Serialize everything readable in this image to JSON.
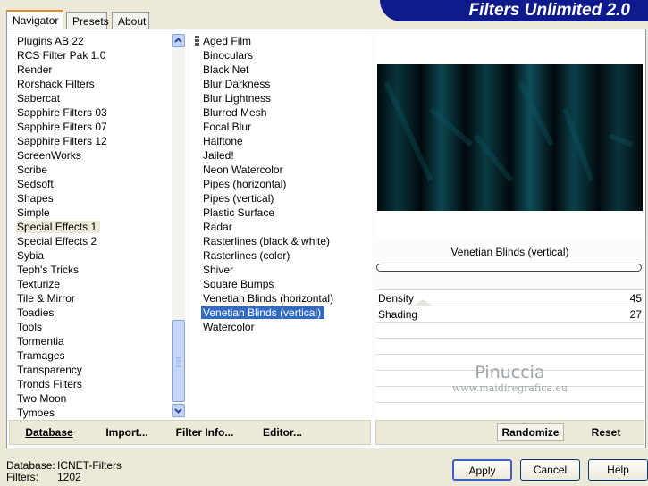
{
  "banner": {
    "title": "Filters Unlimited 2.0"
  },
  "tabs": [
    {
      "label": "Navigator",
      "active": true
    },
    {
      "label": "Presets",
      "active": false
    },
    {
      "label": "About",
      "active": false
    }
  ],
  "categories": {
    "items": [
      "Plugins AB 22",
      "RCS Filter Pak 1.0",
      "Render",
      "Rorshack Filters",
      "Sabercat",
      "Sapphire Filters 03",
      "Sapphire Filters 07",
      "Sapphire Filters 12",
      "ScreenWorks",
      "Scribe",
      "Sedsoft",
      "Shapes",
      "Simple",
      "Special Effects 1",
      "Special Effects 2",
      "Sybia",
      "Teph's Tricks",
      "Texturize",
      "Tile & Mirror",
      "Toadies",
      "Tools",
      "Tormentia",
      "Tramages",
      "Transparency",
      "Tronds Filters",
      "Two Moon",
      "Tymoes"
    ],
    "selected": "Special Effects 1"
  },
  "filters": {
    "items": [
      "Aged Film",
      "Binoculars",
      "Black Net",
      "Blur Darkness",
      "Blur Lightness",
      "Blurred Mesh",
      "Focal Blur",
      "Halftone",
      "Jailed!",
      "Neon Watercolor",
      "Pipes (horizontal)",
      "Pipes (vertical)",
      "Plastic Surface",
      "Radar",
      "Rasterlines (black & white)",
      "Rasterlines (color)",
      "Shiver",
      "Square Bumps",
      "Venetian Blinds (horizontal)",
      "Venetian Blinds (vertical)",
      "Watercolor"
    ],
    "selected": "Venetian Blinds (vertical)"
  },
  "preview": {
    "filter_name": "Venetian Blinds (vertical)",
    "colors": {
      "dark": "#02090c",
      "teal": "#0f5864"
    }
  },
  "params": [
    {
      "label": "Density",
      "value": "45"
    },
    {
      "label": "Shading",
      "value": "27"
    }
  ],
  "watermark": {
    "line1": "Pinuccia",
    "line2": "www.maidiregrafica.eu"
  },
  "bottom_buttons": {
    "database": "Database",
    "import": "Import...",
    "filter_info": "Filter Info...",
    "editor": "Editor..."
  },
  "right_buttons": {
    "randomize": "Randomize",
    "reset": "Reset"
  },
  "status": {
    "database_label": "Database:",
    "database_value": "ICNET-Filters",
    "filters_label": "Filters:",
    "filters_value": "1202"
  },
  "dialog_buttons": {
    "apply": "Apply",
    "cancel": "Cancel",
    "help": "Help"
  },
  "theme": {
    "selection": "#316ac5",
    "highlight_category": "#ece9d8",
    "banner": "#0f1a8c"
  }
}
